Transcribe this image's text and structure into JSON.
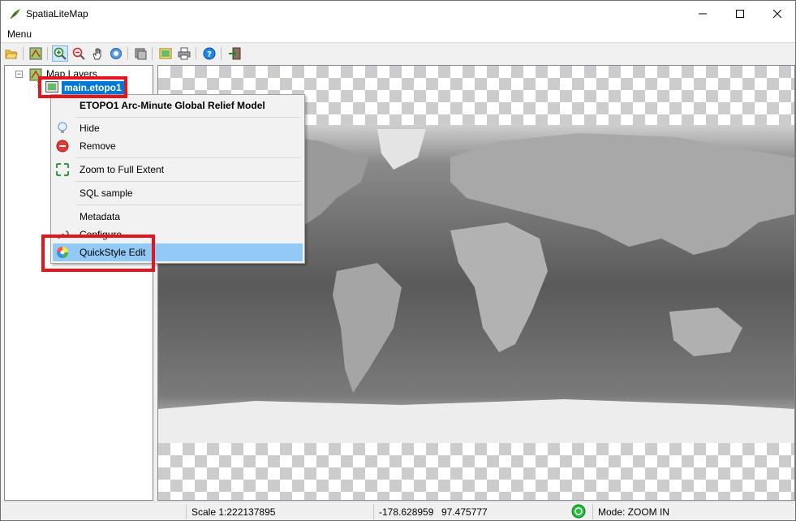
{
  "window": {
    "title": "SpatiaLiteMap",
    "icon": "spatialite-feather-icon"
  },
  "menubar": {
    "menu_label": "Menu"
  },
  "toolbar": {
    "buttons": [
      "open-folder-icon",
      "layer-icon",
      "zoom-in-icon",
      "zoom-out-icon",
      "pan-hand-icon",
      "identify-icon",
      "configure-icon",
      "image-export-icon",
      "print-icon",
      "help-icon",
      "exit-icon"
    ]
  },
  "tree": {
    "root_label": "Map Layers",
    "selected_layer": "main.etopo1"
  },
  "context_menu": {
    "header": "ETOPO1 Arc-Minute Global Relief Model",
    "items": {
      "hide": "Hide",
      "remove": "Remove",
      "zoom_full": "Zoom to Full Extent",
      "sql_sample": "SQL sample",
      "metadata": "Metadata",
      "configure": "Configure",
      "quickstyle": "QuickStyle Edit"
    }
  },
  "statusbar": {
    "scale": "Scale 1:222137895",
    "coord_x": "-178.628959",
    "coord_y": "97.475777",
    "mode": "Mode: ZOOM IN"
  },
  "colors": {
    "selection": "#0078d7",
    "menu_highlight": "#91c9f7",
    "annotation_red": "#e3161d",
    "status_green": "#22c03a"
  }
}
